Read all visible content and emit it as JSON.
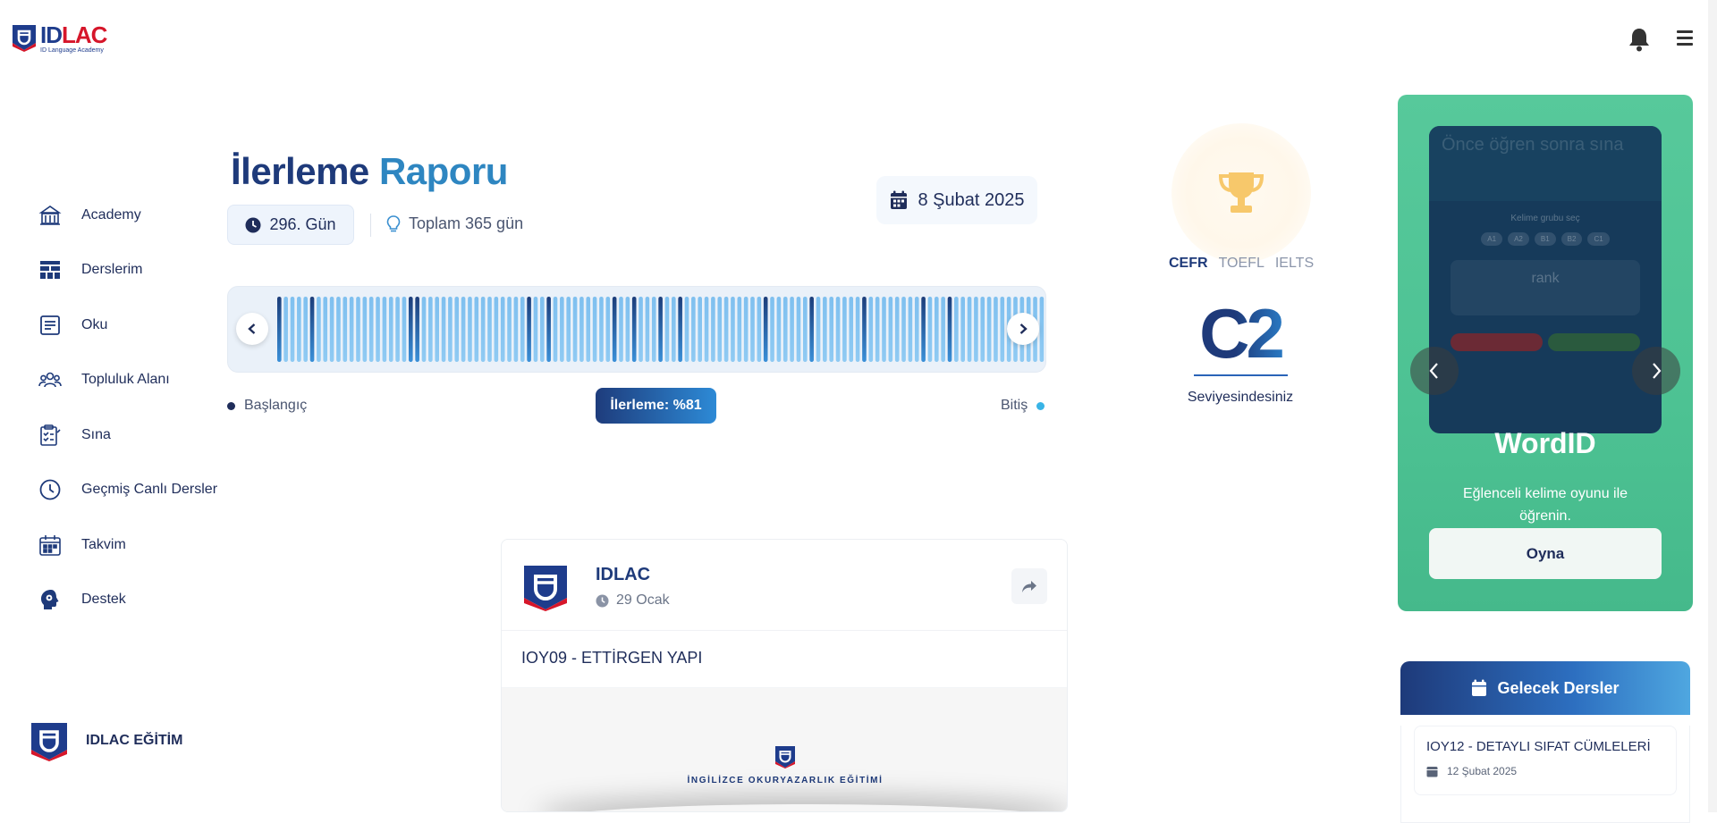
{
  "brand": {
    "logo_main_id": "ID",
    "logo_main_lac": "LAC",
    "logo_sub": "ID Language Academy"
  },
  "sidebar": {
    "items": [
      {
        "label": "Academy",
        "icon": "academy-icon"
      },
      {
        "label": "Derslerim",
        "icon": "lessons-icon"
      },
      {
        "label": "Oku",
        "icon": "read-icon"
      },
      {
        "label": "Topluluk Alanı",
        "icon": "community-icon"
      },
      {
        "label": "Sına",
        "icon": "quiz-icon"
      },
      {
        "label": "Geçmiş Canlı Dersler",
        "icon": "clock-icon"
      },
      {
        "label": "Takvim",
        "icon": "calendar-icon"
      },
      {
        "label": "Destek",
        "icon": "support-icon"
      }
    ],
    "footer_label": "IDLAC EĞİTİM"
  },
  "report": {
    "title_part1": "İlerleme",
    "title_part2": "Raporu",
    "day_label": "296. Gün",
    "total_label": "Toplam 365 gün",
    "date_label": "8 Şubat 2025",
    "start_label": "Başlangıç",
    "end_label": "Bitiş",
    "progress_label": "İlerleme: %81",
    "progress_value": 81,
    "colors": {
      "done": "#1f3f86",
      "light": "#7fc0ef",
      "dark_stripe": "#1c3d7a"
    }
  },
  "level": {
    "tabs": [
      "CEFR",
      "TOEFL",
      "IELTS"
    ],
    "active_tab": "CEFR",
    "value": "C2",
    "caption": "Seviyesindesiniz"
  },
  "wordid": {
    "title": "WordID",
    "description": "Eğlenceli kelime oyunu ile öğrenin.",
    "button": "Oyna",
    "preview_heading": "Önce öğren sonra sına",
    "preview_sub": "Kelime grubu seç",
    "preview_chips": [
      "A1",
      "A2",
      "B1",
      "B2",
      "C1"
    ],
    "preview_card": "rank"
  },
  "upcoming": {
    "title": "Gelecek Dersler",
    "items": [
      {
        "title": "IOY12 - DETAYLI SIFAT CÜMLELERİ",
        "date": "12 Şubat 2025"
      }
    ]
  },
  "post": {
    "author": "IDLAC",
    "time": "29 Ocak",
    "text": "IOY09 - ETTİRGEN YAPI",
    "media_caption": "İNGİLİZCE OKURYAZARLIK EĞİTİMİ"
  }
}
